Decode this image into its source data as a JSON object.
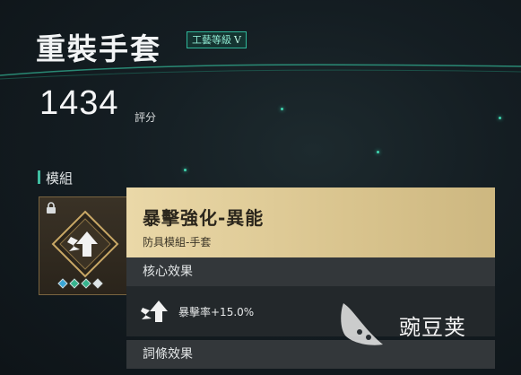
{
  "item": {
    "title": "重裝手套",
    "craft_label": "工藝等級",
    "craft_level": "V"
  },
  "score": {
    "value": "1434",
    "unit": "評分"
  },
  "module_section": {
    "title": "模組"
  },
  "module_slot": {
    "locked_icon": "lock-icon",
    "emblem_icon": "crit-arrow-icon",
    "gem_colors": [
      "#3aa6d6",
      "#36b58e",
      "#36b58e",
      "#e0e6e8"
    ]
  },
  "tooltip": {
    "name": "暴擊強化-異能",
    "type": "防具模組-手套",
    "core_effect_title": "核心效果",
    "core_effect": "暴擊率+15.0%",
    "affix_title": "詞條效果"
  },
  "watermark": {
    "text": "豌豆荚"
  },
  "colors": {
    "accent": "#3fbda0",
    "tooltip_header": "#e2cf9b",
    "background": "#141d22"
  }
}
